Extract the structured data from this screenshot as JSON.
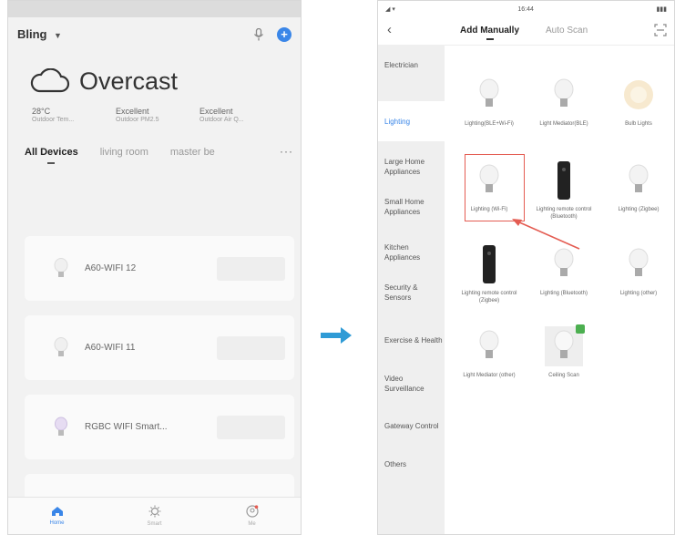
{
  "left": {
    "status": {
      "left": "",
      "center": "",
      "right": ""
    },
    "home_title": "Bling",
    "weather": {
      "condition": "Overcast",
      "stats": [
        {
          "value": "28°C",
          "label": "Outdoor Tem..."
        },
        {
          "value": "Excellent",
          "label": "Outdoor PM2.5"
        },
        {
          "value": "Excellent",
          "label": "Outdoor Air Q..."
        }
      ]
    },
    "rooms": [
      "All Devices",
      "living room",
      "master be"
    ],
    "more": "···",
    "devices": [
      {
        "name": "A60-WIFI 12"
      },
      {
        "name": "A60-WIFI 11"
      },
      {
        "name": "RGBC WIFI Smart..."
      }
    ],
    "nav": [
      "Home",
      "Smart",
      "Me"
    ]
  },
  "right": {
    "status": {
      "time": "16:44"
    },
    "back": "‹",
    "tabs": [
      "Add Manually",
      "Auto Scan"
    ],
    "categories": [
      "Electrician",
      "Lighting",
      "Large Home Appliances",
      "Small Home Appliances",
      "Kitchen Appliances",
      "Security & Sensors",
      "Exercise & Health",
      "Video Surveillance",
      "Gateway Control",
      "Others"
    ],
    "devices": [
      {
        "label": "Lighting(BLE+Wi-Fi)",
        "icon": "bulb-icon"
      },
      {
        "label": "Light Mediator(BLE)",
        "icon": "bulb-icon"
      },
      {
        "label": "Bulb Lights",
        "icon": "glow-icon"
      },
      {
        "label": "Lighting (Wi-Fi)",
        "icon": "bulb-icon"
      },
      {
        "label": "Lighting remote control (Bluetooth)",
        "icon": "remote-icon"
      },
      {
        "label": "Lighting (Zigbee)",
        "icon": "bulb-icon"
      },
      {
        "label": "Lighting remote control (Zigbee)",
        "icon": "remote-icon"
      },
      {
        "label": "Lighting (Bluetooth)",
        "icon": "bulb-icon"
      },
      {
        "label": "Lighting (other)",
        "icon": "bulb-icon"
      },
      {
        "label": "Light Mediator (other)",
        "icon": "bulb-icon"
      },
      {
        "label": "Ceiling Scan",
        "icon": "bulb-icon"
      }
    ]
  },
  "colors": {
    "accent": "#3a86e8",
    "highlight": "#e45c52",
    "arrow": "#2f9bd6"
  }
}
